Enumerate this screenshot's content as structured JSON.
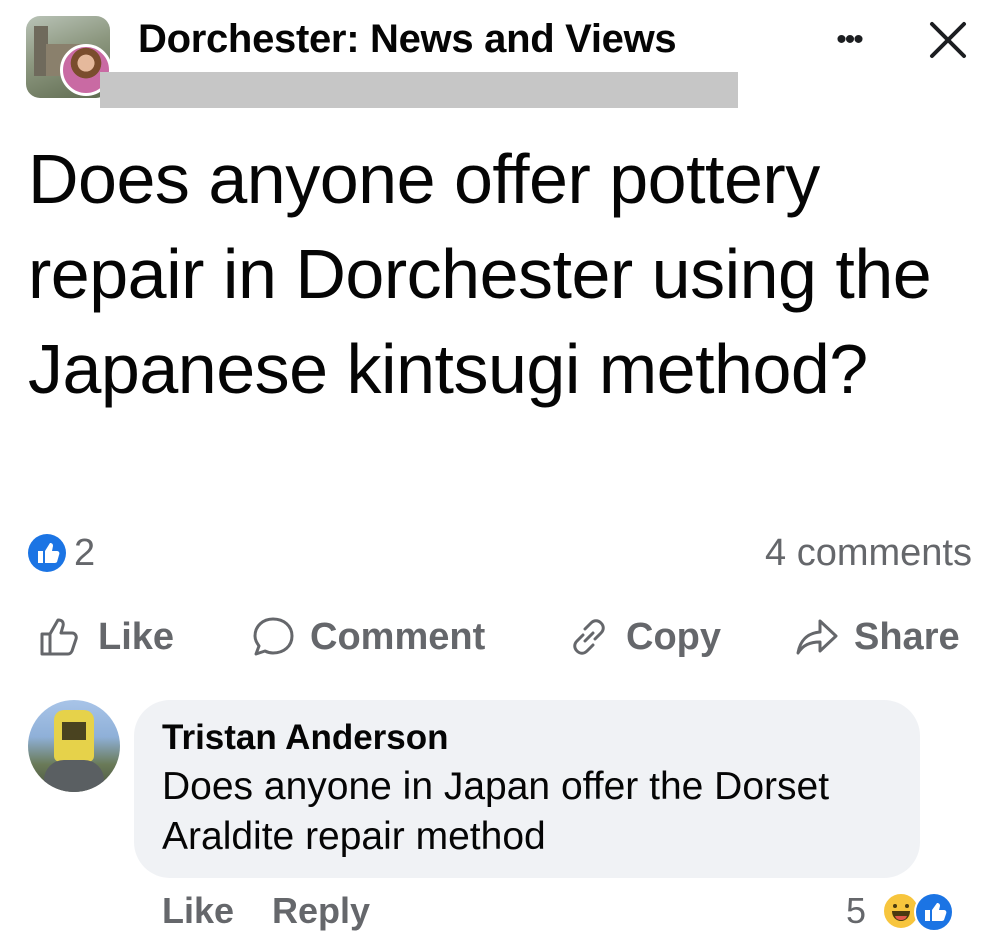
{
  "header": {
    "group_name": "Dorchester: News and Views",
    "more_icon": "more-horizontal-icon",
    "close_icon": "close-icon"
  },
  "post": {
    "text": "Does anyone offer pottery repair in Dorchester using the Japanese kintsugi method?",
    "reaction_count": "2",
    "comment_count": "4 comments"
  },
  "actions": {
    "like": "Like",
    "comment": "Comment",
    "copy": "Copy",
    "share": "Share"
  },
  "comment": {
    "author": "Tristan Anderson",
    "text": "Does anyone in Japan offer the Dorset Araldite repair method",
    "like_label": "Like",
    "reply_label": "Reply",
    "reaction_count": "5"
  },
  "colors": {
    "accent": "#1b74e4",
    "muted_text": "#65676b",
    "bubble": "#f0f2f5",
    "redaction": "#c6c6c6"
  }
}
